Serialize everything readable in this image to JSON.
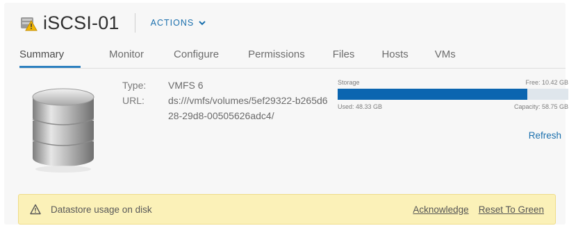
{
  "header": {
    "title": "iSCSI-01",
    "actions_label": "ACTIONS"
  },
  "tabs": [
    {
      "label": "Summary",
      "active": true
    },
    {
      "label": "Monitor",
      "active": false
    },
    {
      "label": "Configure",
      "active": false
    },
    {
      "label": "Permissions",
      "active": false
    },
    {
      "label": "Files",
      "active": false
    },
    {
      "label": "Hosts",
      "active": false
    },
    {
      "label": "VMs",
      "active": false
    }
  ],
  "properties": {
    "type_label": "Type:",
    "type_value": "VMFS 6",
    "url_label": "URL:",
    "url_value": "ds:///vmfs/volumes/5ef29322-b265d628-29d8-00505626adc4/"
  },
  "storage": {
    "label": "Storage",
    "free": "Free: 10.42 GB",
    "used": "Used: 48.33 GB",
    "capacity": "Capacity: 58.75 GB",
    "used_fraction": 0.823,
    "refresh_label": "Refresh"
  },
  "alert": {
    "message": "Datastore usage on disk",
    "acknowledge_label": "Acknowledge",
    "reset_label": "Reset To Green"
  },
  "colors": {
    "accent": "#1a6fad",
    "bar_fill": "#0b65b0",
    "alert_bg": "#fbf1b8"
  }
}
